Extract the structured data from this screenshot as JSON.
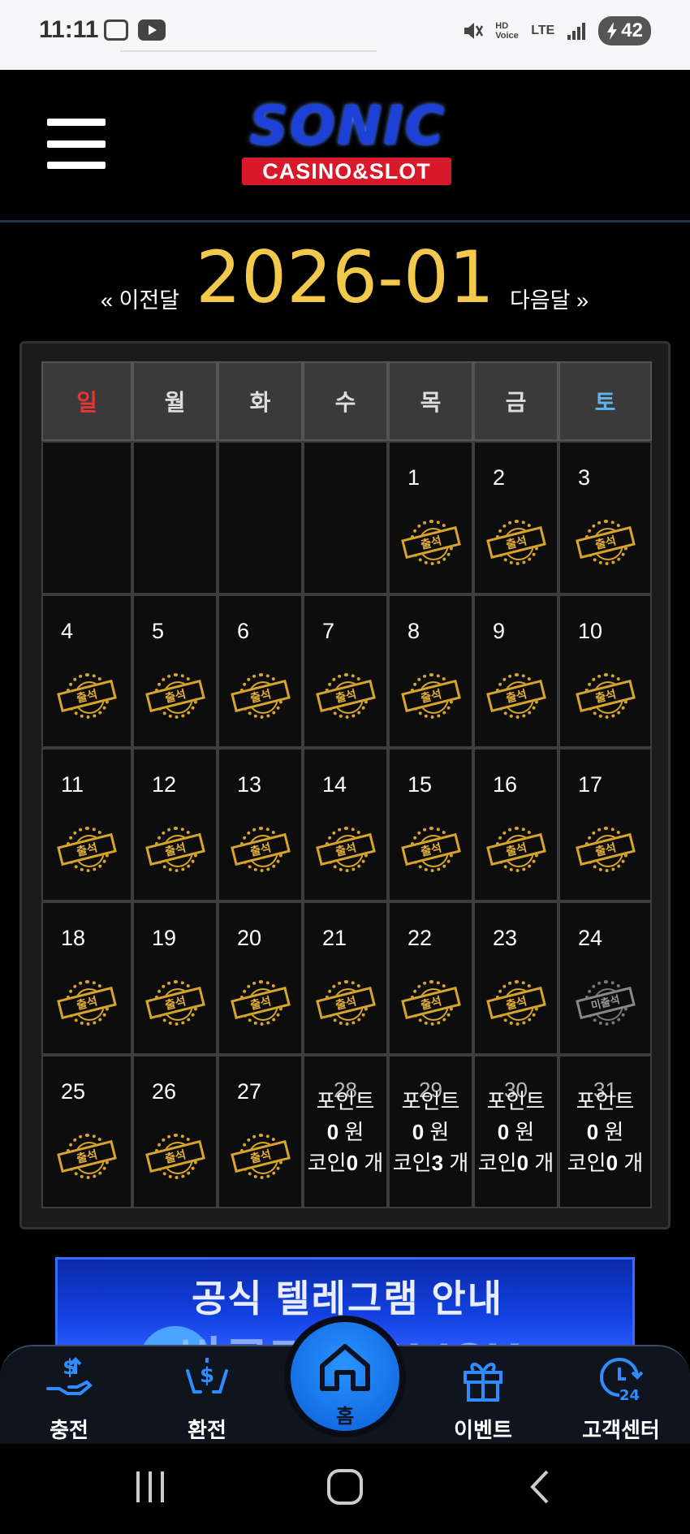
{
  "status_bar": {
    "time": "11:11",
    "network": "LTE",
    "hd_voice": "HD Voice",
    "battery": "42"
  },
  "header": {
    "logo_main": "SONIC",
    "logo_sub": "CASINO&SLOT"
  },
  "calendar": {
    "prev_label": "« 이전달",
    "title": "2026-01",
    "next_label": "다음달 »",
    "weekdays": [
      "일",
      "월",
      "화",
      "수",
      "목",
      "금",
      "토"
    ],
    "stamp_attended": "출석",
    "stamp_missed": "미출석",
    "weeks": [
      [
        {
          "day": ""
        },
        {
          "day": ""
        },
        {
          "day": ""
        },
        {
          "day": ""
        },
        {
          "day": "1",
          "status": "attended"
        },
        {
          "day": "2",
          "status": "attended"
        },
        {
          "day": "3",
          "status": "attended"
        }
      ],
      [
        {
          "day": "4",
          "status": "attended"
        },
        {
          "day": "5",
          "status": "attended"
        },
        {
          "day": "6",
          "status": "attended"
        },
        {
          "day": "7",
          "status": "attended"
        },
        {
          "day": "8",
          "status": "attended"
        },
        {
          "day": "9",
          "status": "attended"
        },
        {
          "day": "10",
          "status": "attended"
        }
      ],
      [
        {
          "day": "11",
          "status": "attended"
        },
        {
          "day": "12",
          "status": "attended"
        },
        {
          "day": "13",
          "status": "attended"
        },
        {
          "day": "14",
          "status": "attended"
        },
        {
          "day": "15",
          "status": "attended"
        },
        {
          "day": "16",
          "status": "attended"
        },
        {
          "day": "17",
          "status": "attended"
        }
      ],
      [
        {
          "day": "18",
          "status": "attended"
        },
        {
          "day": "19",
          "status": "attended"
        },
        {
          "day": "20",
          "status": "attended"
        },
        {
          "day": "21",
          "status": "attended"
        },
        {
          "day": "22",
          "status": "attended"
        },
        {
          "day": "23",
          "status": "attended"
        },
        {
          "day": "24",
          "status": "missed"
        }
      ],
      [
        {
          "day": "25",
          "status": "attended"
        },
        {
          "day": "26",
          "status": "attended"
        },
        {
          "day": "27",
          "status": "attended"
        },
        {
          "day": "28",
          "status": "future",
          "point_label": "포인트",
          "point_value": "0",
          "point_unit": "원",
          "coin_label": "코인",
          "coin_value": "0",
          "coin_unit": "개"
        },
        {
          "day": "29",
          "status": "future",
          "point_label": "포인트",
          "point_value": "0",
          "point_unit": "원",
          "coin_label": "코인",
          "coin_value": "3",
          "coin_unit": "개"
        },
        {
          "day": "30",
          "status": "future",
          "point_label": "포인트",
          "point_value": "0",
          "point_unit": "원",
          "coin_label": "코인",
          "coin_value": "0",
          "coin_unit": "개"
        },
        {
          "day": "31",
          "status": "future",
          "point_label": "포인트",
          "point_value": "0",
          "point_unit": "원",
          "coin_label": "코인",
          "coin_value": "0",
          "coin_unit": "개"
        }
      ]
    ]
  },
  "banner": {
    "title": "공식 텔레그램 안내",
    "subtitle": "바로가기 CLICK"
  },
  "bottom_nav": {
    "charge": "충전",
    "exchange": "환전",
    "home": "홈",
    "event": "이벤트",
    "support": "고객센터"
  },
  "colors": {
    "accent_gold": "#f2c94c",
    "sunday_red": "#e53535",
    "saturday_blue": "#5fb3ea",
    "primary_blue": "#1e7ff0"
  }
}
